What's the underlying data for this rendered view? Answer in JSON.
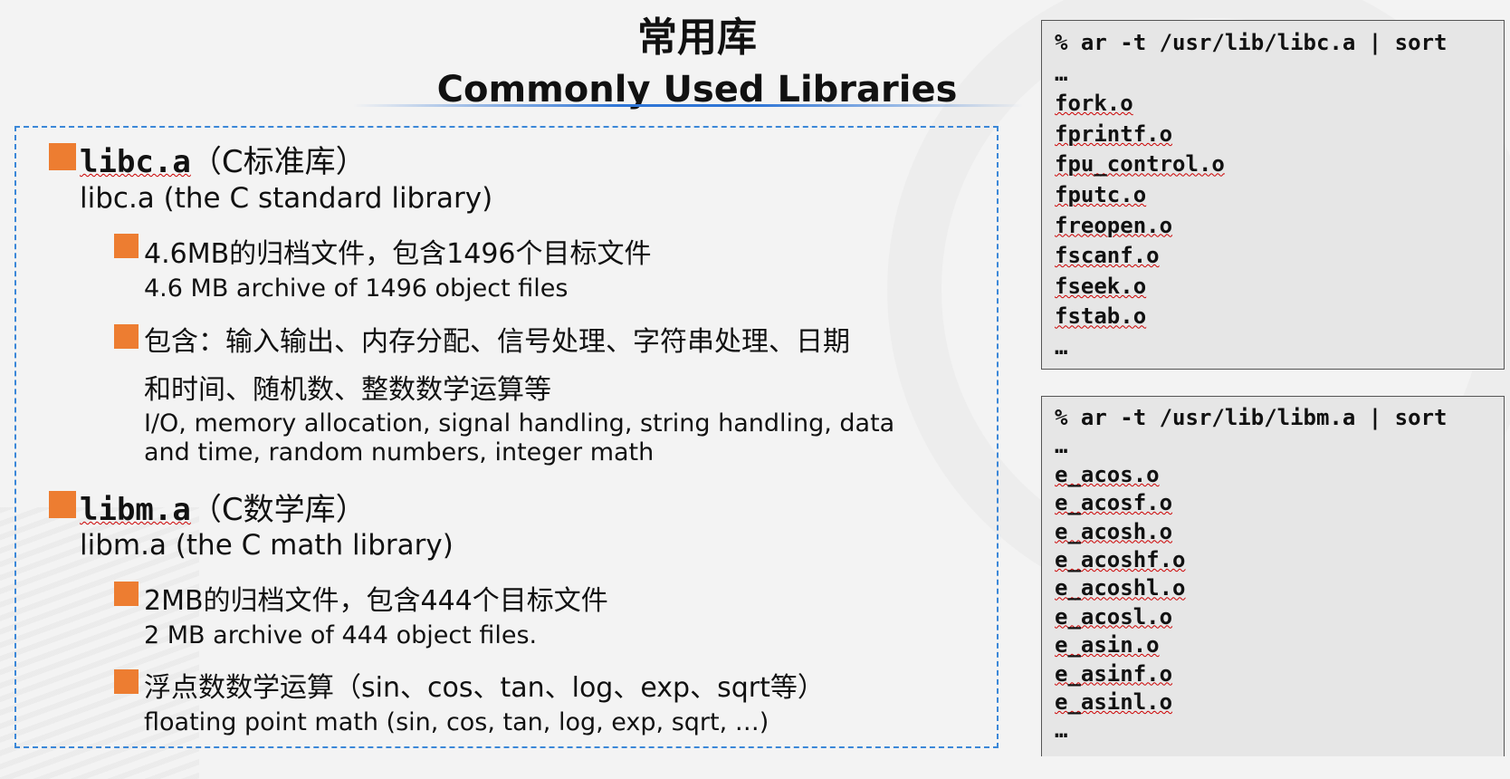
{
  "title": {
    "zh": "常用库",
    "en": "Commonly Used Libraries"
  },
  "libc": {
    "name": "libc.a",
    "zh_label": "（C标准库）",
    "en_line": "libc.a (the C standard library)",
    "points": [
      {
        "zh": "4.6MB的归档文件，包含1496个目标文件",
        "en": "4.6 MB archive of 1496 object files"
      },
      {
        "zh1": "包含：输入输出、内存分配、信号处理、字符串处理、日期",
        "zh2": "和时间、随机数、整数数学运算等",
        "en1": "I/O, memory allocation, signal handling, string handling, data",
        "en2": "and time, random numbers, integer math"
      }
    ]
  },
  "libm": {
    "name": "libm.a",
    "zh_label": "（C数学库）",
    "en_line": "libm.a (the C math library)",
    "points": [
      {
        "zh": "2MB的归档文件，包含444个目标文件",
        "en": "2 MB archive of 444 object files."
      },
      {
        "zh": "浮点数数学运算（sin、cos、tan、log、exp、sqrt等）",
        "en": "floating point math (sin, cos, tan, log, exp, sqrt, …)"
      }
    ]
  },
  "terminal_libc": {
    "command": "% ar -t /usr/lib/libc.a | sort",
    "lines": [
      "…",
      "fork.o",
      "fprintf.o",
      "fpu_control.o",
      "fputc.o",
      "freopen.o",
      "fscanf.o",
      "fseek.o",
      "fstab.o",
      "…"
    ]
  },
  "terminal_libm": {
    "command": "% ar -t /usr/lib/libm.a | sort",
    "lines": [
      "…",
      "e_acos.o",
      "e_acosf.o",
      "e_acosh.o",
      "e_acoshf.o",
      "e_acoshl.o",
      "e_acosl.o",
      "e_asin.o",
      "e_asinf.o",
      "e_asinl.o",
      "…"
    ]
  },
  "colors": {
    "bullet": "#ed7d31",
    "dashed_border": "#3b87d8",
    "title_rule": "#2e75d6",
    "terminal_bg": "#e6e6e6",
    "spellcheck": "#cc0000"
  }
}
